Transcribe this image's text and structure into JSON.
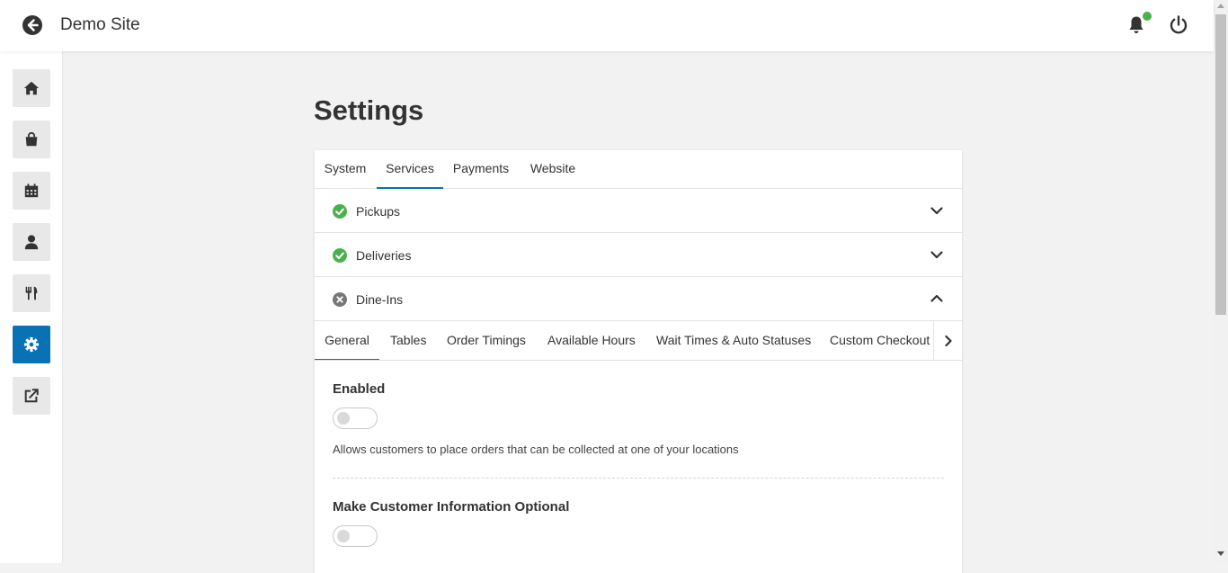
{
  "header": {
    "site_title": "Demo Site",
    "back_icon": "arrow-left-circle-icon",
    "notification_icon": "bell-icon",
    "notification_dot_color": "#4caf50",
    "power_icon": "power-icon"
  },
  "sidebar": {
    "items": [
      {
        "icon": "home-icon",
        "active": false
      },
      {
        "icon": "shopping-bag-icon",
        "active": false
      },
      {
        "icon": "calendar-icon",
        "active": false
      },
      {
        "icon": "user-icon",
        "active": false
      },
      {
        "icon": "utensils-icon",
        "active": false
      },
      {
        "icon": "gear-icon",
        "active": true
      },
      {
        "icon": "external-link-icon",
        "active": false
      }
    ],
    "active_color": "#0872b5"
  },
  "page": {
    "title": "Settings"
  },
  "tabs": [
    {
      "label": "System",
      "active": false
    },
    {
      "label": "Services",
      "active": true
    },
    {
      "label": "Payments",
      "active": false
    },
    {
      "label": "Website",
      "active": false
    }
  ],
  "services": [
    {
      "label": "Pickups",
      "status": "enabled",
      "expanded": false
    },
    {
      "label": "Deliveries",
      "status": "enabled",
      "expanded": false
    },
    {
      "label": "Dine-Ins",
      "status": "disabled",
      "expanded": true
    }
  ],
  "dine_ins": {
    "subtabs": [
      {
        "label": "General",
        "active": true
      },
      {
        "label": "Tables",
        "active": false
      },
      {
        "label": "Order Timings",
        "active": false
      },
      {
        "label": "Available Hours",
        "active": false
      },
      {
        "label": "Wait Times & Auto Statuses",
        "active": false
      },
      {
        "label": "Custom Checkout Fields",
        "active": false
      }
    ],
    "fields": [
      {
        "title": "Enabled",
        "enabled": false,
        "description": "Allows customers to place orders that can be collected at one of your locations"
      },
      {
        "title": "Make Customer Information Optional",
        "enabled": false,
        "description": ""
      }
    ]
  },
  "colors": {
    "accent": "#0872b5",
    "success": "#4caf50",
    "muted_status": "#777777"
  }
}
